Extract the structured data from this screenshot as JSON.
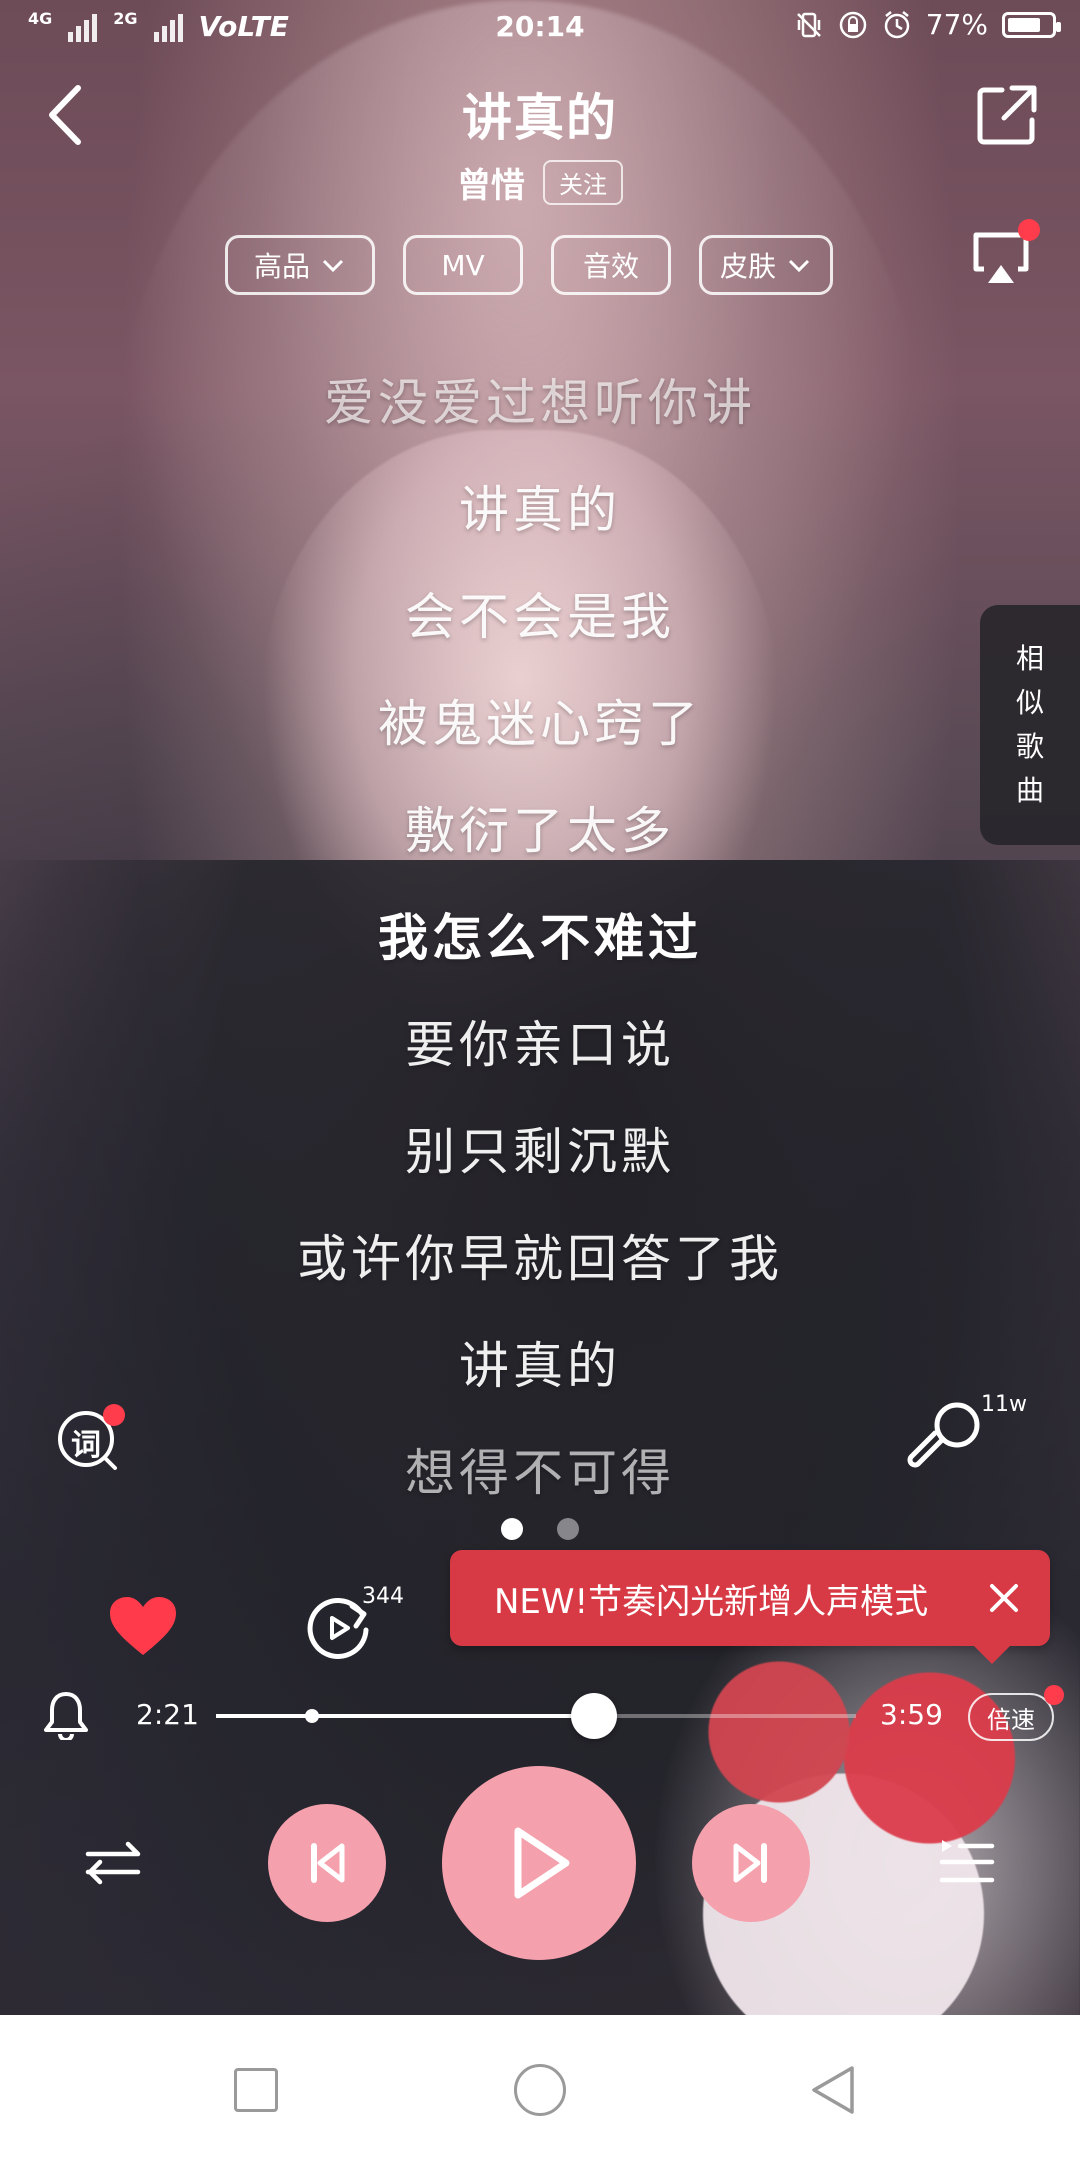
{
  "status": {
    "network_1": "4G",
    "network_2": "2G",
    "volte": "VoLTE",
    "time": "20:14",
    "battery_pct": "77%",
    "battery_level": 0.77
  },
  "header": {
    "song_title": "讲真的",
    "artist": "曾惜",
    "follow_label": "关注"
  },
  "chips": [
    {
      "label": "高品",
      "has_dropdown": true
    },
    {
      "label": "MV",
      "has_dropdown": false
    },
    {
      "label": "音效",
      "has_dropdown": false
    },
    {
      "label": "皮肤",
      "has_dropdown": true
    }
  ],
  "side_tab": {
    "label_chars": [
      "相",
      "似",
      "歌",
      "曲"
    ]
  },
  "lyrics": [
    {
      "text": "爱没爱过想听你讲",
      "state": "faded"
    },
    {
      "text": "讲真的",
      "state": "normal"
    },
    {
      "text": "会不会是我",
      "state": "normal"
    },
    {
      "text": "被鬼迷心窍了",
      "state": "normal"
    },
    {
      "text": "敷衍了太多",
      "state": "normal"
    },
    {
      "text": "我怎么不难过",
      "state": "current"
    },
    {
      "text": "要你亲口说",
      "state": "normal"
    },
    {
      "text": "别只剩沉默",
      "state": "normal"
    },
    {
      "text": "或许你早就回答了我",
      "state": "normal"
    },
    {
      "text": "讲真的",
      "state": "normal"
    },
    {
      "text": "想得不可得",
      "state": "faded"
    }
  ],
  "tools": {
    "lyric_button_label": "词",
    "mic_count": "11w"
  },
  "actions": {
    "replay_count": "344"
  },
  "toast": {
    "text": "NEW!节奏闪光新增人声模式"
  },
  "progress": {
    "current_time": "2:21",
    "total_time": "3:59",
    "fraction": 0.59,
    "marker_fraction": 0.15,
    "speed_label": "倍速"
  },
  "colors": {
    "accent_pink": "#f4a0ad",
    "toast_red": "#d83a45",
    "badge_red": "#ff3c4c",
    "heart_red": "#ff3b4b"
  },
  "icons": [
    "back-icon",
    "share-icon",
    "cast-icon",
    "lyric-icon",
    "mic-icon",
    "heart-icon",
    "replay-icon",
    "close-icon",
    "bell-icon",
    "prev-icon",
    "play-icon",
    "next-icon",
    "shuffle-icon",
    "queue-icon"
  ]
}
